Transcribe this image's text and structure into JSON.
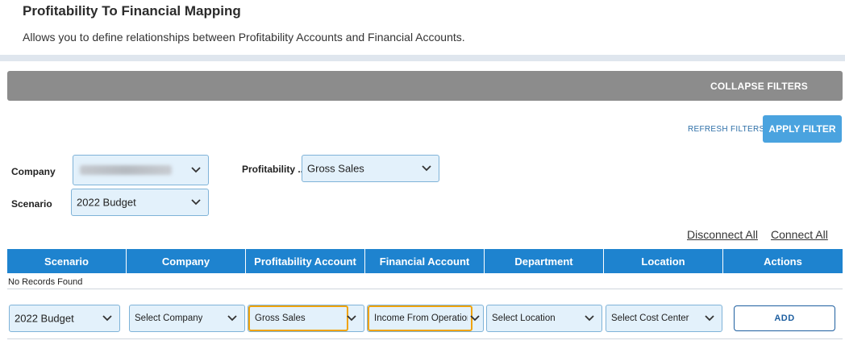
{
  "page": {
    "title": "Profitability To Financial Mapping",
    "description": "Allows you to define relationships between Profitability Accounts and Financial Accounts."
  },
  "filters": {
    "collapse_label": "COLLAPSE FILTERS",
    "refresh_label": "REFRESH FILTERS",
    "apply_label": "APPLY FILTER",
    "company_label": "Company",
    "company_value": "",
    "scenario_label": "Scenario",
    "scenario_value": "2022 Budget",
    "profitability_label": "Profitability ...",
    "profitability_value": "Gross Sales"
  },
  "links": {
    "disconnect_all": "Disconnect All",
    "connect_all": "Connect All"
  },
  "table": {
    "columns": [
      "Scenario",
      "Company",
      "Profitability Account",
      "Financial Account",
      "Department",
      "Location",
      "Actions"
    ],
    "empty_message": "No Records Found"
  },
  "new_row": {
    "scenario": "2022 Budget",
    "company": "Select Company",
    "profitability_account": "Gross Sales",
    "financial_account": "Income From Operations",
    "department": "Select Location",
    "location": "Select Cost Center",
    "add_label": "ADD"
  },
  "colors": {
    "header_blue": "#1e83cf",
    "apply_blue": "#4aa3df",
    "filter_bar_gray": "#8c8c8c",
    "select_bg": "#e3f1fb",
    "highlight_orange": "#f0a30a"
  },
  "icons": {
    "dropdown": "chevron-down-icon"
  }
}
